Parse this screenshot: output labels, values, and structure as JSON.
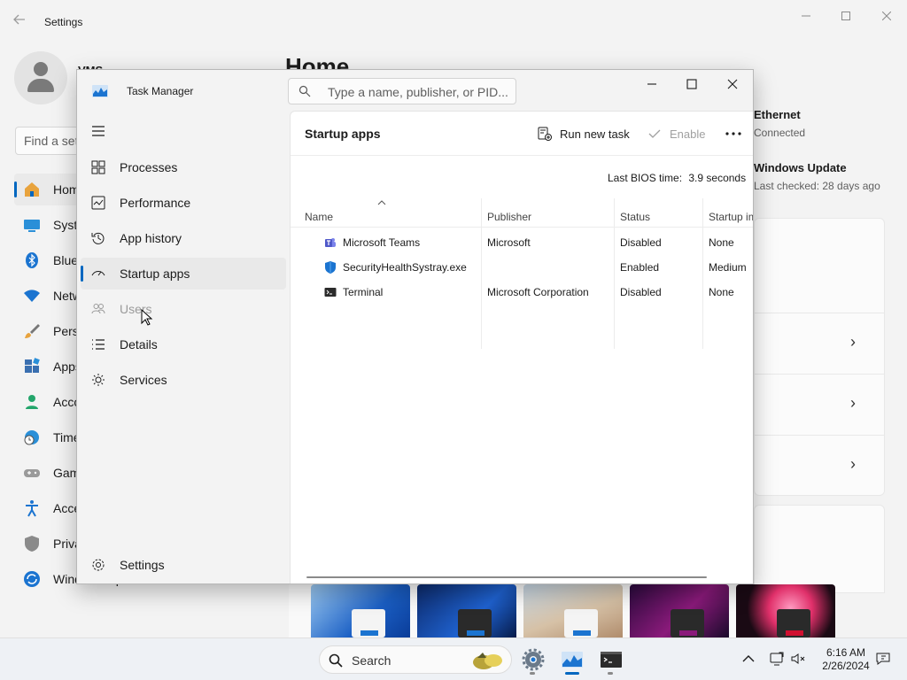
{
  "settings": {
    "title": "Settings",
    "user_name": "VMS",
    "search_placeholder": "Find a setting",
    "heading": "Home",
    "nav": [
      {
        "label": "Home",
        "icon": "home-icon"
      },
      {
        "label": "System",
        "icon": "system-icon"
      },
      {
        "label": "Bluetooth & devices",
        "icon": "bluetooth-icon"
      },
      {
        "label": "Network & internet",
        "icon": "wifi-icon"
      },
      {
        "label": "Personalization",
        "icon": "brush-icon"
      },
      {
        "label": "Apps",
        "icon": "apps-icon"
      },
      {
        "label": "Accounts",
        "icon": "account-icon"
      },
      {
        "label": "Time & language",
        "icon": "clock-globe-icon"
      },
      {
        "label": "Gaming",
        "icon": "gamepad-icon"
      },
      {
        "label": "Accessibility",
        "icon": "accessibility-icon"
      },
      {
        "label": "Privacy & security",
        "icon": "shield-icon"
      },
      {
        "label": "Windows Update",
        "icon": "update-icon"
      }
    ],
    "ethernet_label": "Ethernet",
    "ethernet_status": "Connected",
    "update_label": "Windows Update",
    "update_status": "Last checked: 28 days ago"
  },
  "taskmanager": {
    "title": "Task Manager",
    "search_placeholder": "Type a name, publisher, or PID...",
    "nav": [
      {
        "label": "Processes",
        "icon": "processes-icon"
      },
      {
        "label": "Performance",
        "icon": "performance-icon"
      },
      {
        "label": "App history",
        "icon": "history-icon"
      },
      {
        "label": "Startup apps",
        "icon": "startup-icon"
      },
      {
        "label": "Users",
        "icon": "users-icon"
      },
      {
        "label": "Details",
        "icon": "details-icon"
      },
      {
        "label": "Services",
        "icon": "services-icon"
      }
    ],
    "settings_label": "Settings",
    "page_title": "Startup apps",
    "run_new_task": "Run new task",
    "enable": "Enable",
    "bios_label": "Last BIOS time:",
    "bios_value": "3.9 seconds",
    "columns": [
      "Name",
      "Publisher",
      "Status",
      "Startup impact"
    ],
    "rows": [
      {
        "name": "Microsoft Teams",
        "publisher": "Microsoft",
        "status": "Disabled",
        "impact": "None",
        "icon": "teams-icon"
      },
      {
        "name": "SecurityHealthSystray.exe",
        "publisher": "",
        "status": "Enabled",
        "impact": "Medium",
        "icon": "security-shield-icon"
      },
      {
        "name": "Terminal",
        "publisher": "Microsoft Corporation",
        "status": "Disabled",
        "impact": "None",
        "icon": "terminal-icon"
      }
    ]
  },
  "taskbar": {
    "search_label": "Search",
    "time": "6:16 AM",
    "date": "2/26/2024"
  },
  "colors": {
    "accent": "#0067c0",
    "selected_nav": "#e9e9e9"
  }
}
